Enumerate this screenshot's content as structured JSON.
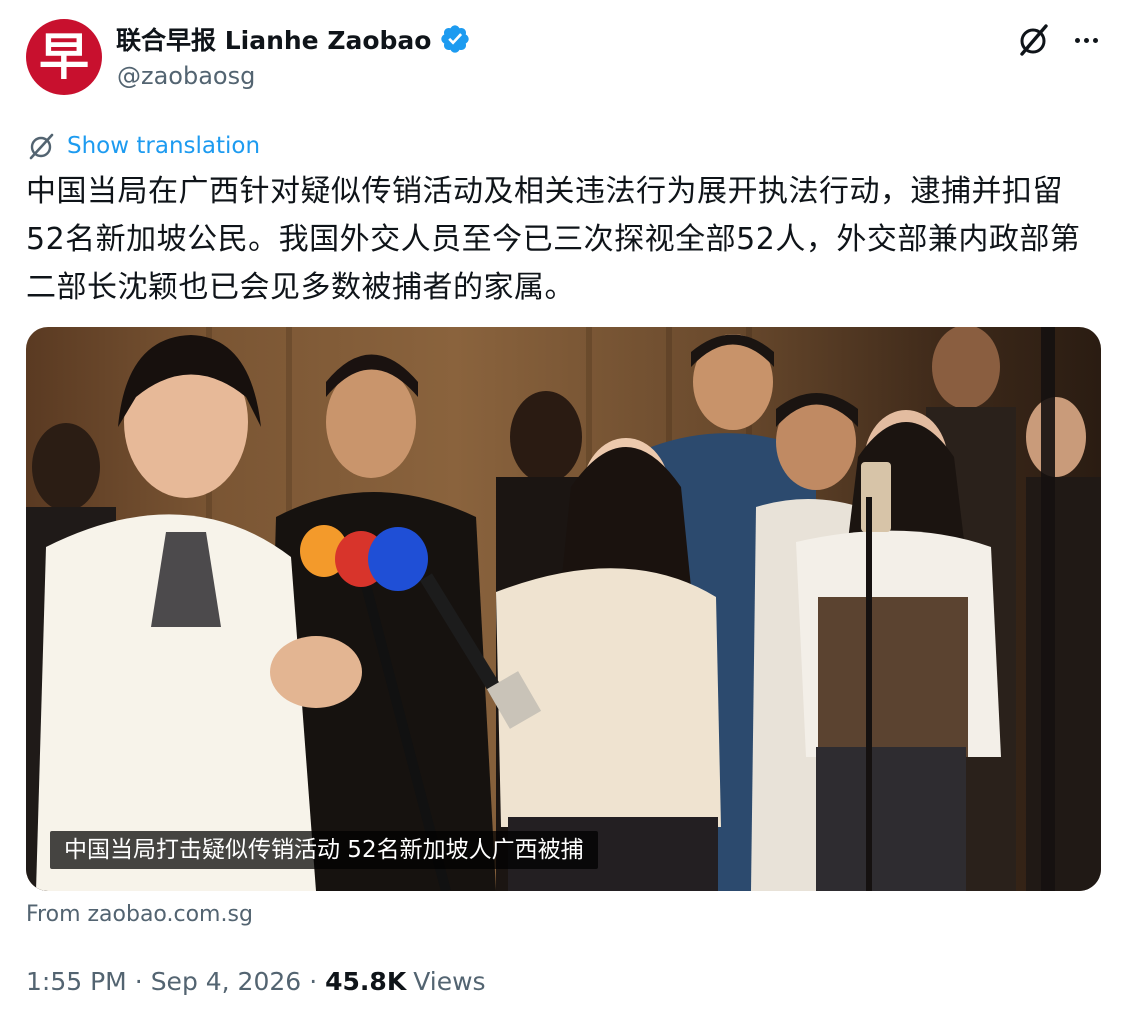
{
  "author": {
    "avatar_glyph": "早",
    "avatar_color": "#c8102e",
    "display_name": "联合早报 Lianhe Zaobao",
    "handle": "@zaobaosg",
    "verified_color": "#1d9bf0"
  },
  "actions": {
    "grok_icon": "grok-slash-circle-icon",
    "more_icon": "ellipsis-icon"
  },
  "translation": {
    "label": "Show translation",
    "icon": "translate-icon"
  },
  "tweet": {
    "text": "中国当局在广西针对疑似传销活动及相关违法行为展开执法行动，逮捕并扣留52名新加坡公民。我国外交人员至今已三次探视全部52人，外交部兼内政部第二部长沈颖也已会见多数被捕者的家属。"
  },
  "card": {
    "caption": "中国当局打击疑似传销活动 52名新加坡人广西被捕",
    "source": "From zaobao.com.sg"
  },
  "meta": {
    "time": "1:55 PM",
    "separator": "·",
    "date": "Sep 4, 2026",
    "views_count": "45.8K",
    "views_label": "Views"
  },
  "colors": {
    "accent": "#1d9bf0",
    "secondary_text": "#536471",
    "primary_text": "#0f1419"
  }
}
